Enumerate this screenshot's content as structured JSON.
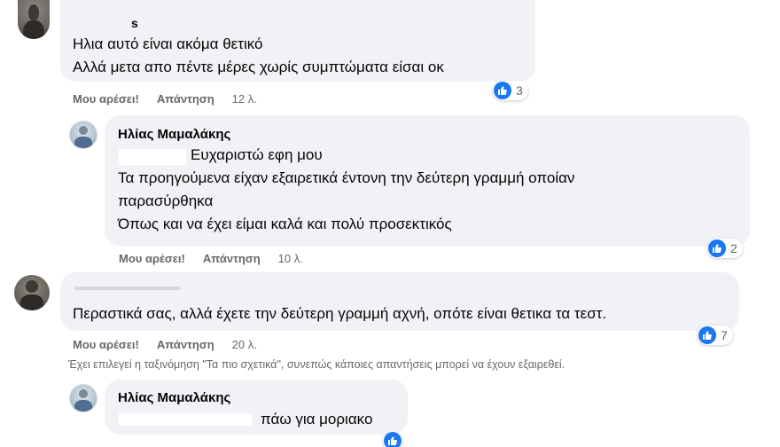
{
  "comments": [
    {
      "author": "s",
      "lines": [
        "Ηλια αυτό είναι ακόμα θετικό",
        "Αλλά μετα απο πέντε μέρες χωρίς συμπτώματα είσαι οκ"
      ],
      "like_label": "Μου αρέσει!",
      "reply_label": "Απάντηση",
      "time": "12 λ.",
      "reactions": "3"
    },
    {
      "author": "Ηλίας Μαμαλάκης",
      "lines": [
        "Ευχαριστώ εφη μου",
        "Τα προηγούμενα είχαν εξαιρετικά έντονη την δεύτερη γραμμή οποίαν",
        "παρασύρθηκα",
        "Όπως και να έχει είμαι καλά και πολύ προσεκτικός"
      ],
      "like_label": "Μου αρέσει!",
      "reply_label": "Απάντηση",
      "time": "10 λ.",
      "reactions": "2"
    },
    {
      "author": "",
      "lines": [
        "Περαστικά σας, αλλά έχετε την δεύτερη γραμμή αχνή, οπότε είναι θετικα τα τεστ."
      ],
      "like_label": "Μου αρέσει!",
      "reply_label": "Απάντηση",
      "time": "20 λ.",
      "reactions": "7"
    },
    {
      "author": "Ηλίας Μαμαλάκης",
      "lines": [
        "πάω για μοριακο"
      ]
    }
  ],
  "sort_notice": "Έχει επιλεγεί η ταξινόμηση \"Τα πιο σχετικά\", συνεπώς κάποιες απαντήσεις μπορεί να έχουν εξαιρεθεί.",
  "colors": {
    "bubble": "#f0f2f5",
    "like": "#1877f2",
    "meta": "#65676b"
  }
}
